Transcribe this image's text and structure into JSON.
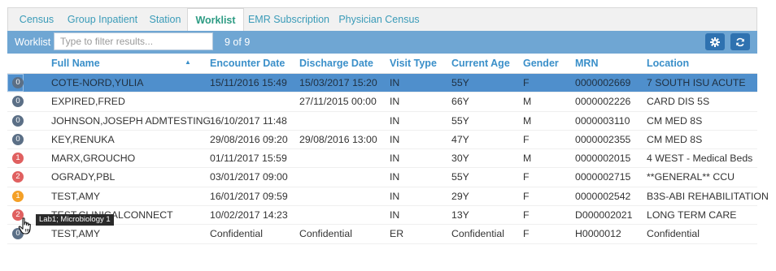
{
  "tabs": [
    "Census",
    "Group Inpatient",
    "Station",
    "Worklist",
    "EMR Subscription",
    "Physician Census"
  ],
  "active_tab": "Worklist",
  "toolbar": {
    "title": "Worklist",
    "filter_placeholder": "Type to filter results...",
    "count": "9 of 9",
    "settings_icon": "gear-icon",
    "refresh_icon": "refresh-icon",
    "accent": "#6fa6d3"
  },
  "columns": [
    "Full Name",
    "Encounter Date",
    "Discharge Date",
    "Visit Type",
    "Current Age",
    "Gender",
    "MRN",
    "Location"
  ],
  "sort": {
    "column": "Full Name",
    "direction": "ascending"
  },
  "badge_colors": {
    "grey": "#5b6f86",
    "red": "#e06060",
    "orange": "#f4a027"
  },
  "rows": [
    {
      "badge": "0",
      "badge_color": "grey",
      "selected": true,
      "name": "COTE-NORD,YULIA",
      "encounter": "15/11/2016 15:49",
      "discharge": "15/03/2017 15:20",
      "visit": "IN",
      "age": "55Y",
      "gender": "F",
      "mrn": "0000002669",
      "location": "7 SOUTH ISU ACUTE"
    },
    {
      "badge": "0",
      "badge_color": "grey",
      "selected": false,
      "name": "EXPIRED,FRED",
      "encounter": "",
      "discharge": "27/11/2015 00:00",
      "visit": "IN",
      "age": "66Y",
      "gender": "M",
      "mrn": "0000002226",
      "location": "CARD DIS 5S"
    },
    {
      "badge": "0",
      "badge_color": "grey",
      "selected": false,
      "name": "JOHNSON,JOSEPH ADMTESTING",
      "encounter": "16/10/2017 11:48",
      "discharge": "",
      "visit": "IN",
      "age": "55Y",
      "gender": "M",
      "mrn": "0000003110",
      "location": "CM MED 8S"
    },
    {
      "badge": "0",
      "badge_color": "grey",
      "selected": false,
      "name": "KEY,RENUKA",
      "encounter": "29/08/2016 09:20",
      "discharge": "29/08/2016 13:00",
      "visit": "IN",
      "age": "47Y",
      "gender": "F",
      "mrn": "0000002355",
      "location": "CM MED 8S"
    },
    {
      "badge": "1",
      "badge_color": "red",
      "selected": false,
      "name": "MARX,GROUCHO",
      "encounter": "01/11/2017 15:59",
      "discharge": "",
      "visit": "IN",
      "age": "30Y",
      "gender": "M",
      "mrn": "0000002015",
      "location": "4 WEST - Medical Beds"
    },
    {
      "badge": "2",
      "badge_color": "red",
      "selected": false,
      "name": "OGRADY,PBL",
      "encounter": "03/01/2017 09:00",
      "discharge": "",
      "visit": "IN",
      "age": "55Y",
      "gender": "F",
      "mrn": "0000002715",
      "location": "**GENERAL** CCU"
    },
    {
      "badge": "1",
      "badge_color": "orange",
      "selected": false,
      "name": "TEST,AMY",
      "encounter": "16/01/2017 09:59",
      "discharge": "",
      "visit": "IN",
      "age": "29Y",
      "gender": "F",
      "mrn": "0000002542",
      "location": "B3S-ABI REHABILITATION"
    },
    {
      "badge": "2",
      "badge_color": "red",
      "selected": false,
      "name": "TEST,CLINICALCONNECT",
      "encounter": "10/02/2017 14:23",
      "discharge": "",
      "visit": "IN",
      "age": "13Y",
      "gender": "F",
      "mrn": "D000002021",
      "location": "LONG TERM CARE"
    },
    {
      "badge": "0",
      "badge_color": "grey",
      "selected": false,
      "name": "TEST,AMY",
      "encounter": "Confidential",
      "discharge": "Confidential",
      "visit": "ER",
      "age": "Confidential",
      "gender": "F",
      "mrn": "H0000012",
      "location": "Confidential"
    }
  ],
  "tooltip": "Lab1; Microbiology 1"
}
